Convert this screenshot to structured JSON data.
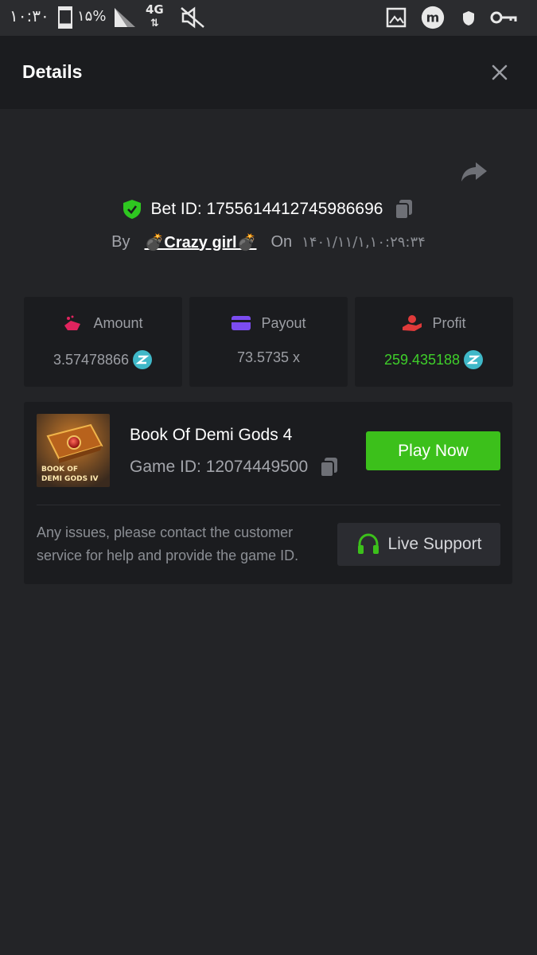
{
  "status_bar": {
    "time": "۱۰:۳۰",
    "battery": "۱۵%",
    "network": "4G",
    "icons": [
      "battery-icon",
      "signal-icon",
      "mute-icon",
      "gallery-icon",
      "app-m-icon",
      "shield-icon",
      "vpn-key-icon"
    ]
  },
  "header": {
    "title": "Details",
    "close_icon": "close-icon"
  },
  "bet": {
    "id_label": "Bet ID: 1755614412745986696",
    "by_label": "By",
    "user": "💣Crazy girl💣",
    "on_label": "On",
    "date": "۱۴۰۱/۱۱/۱,۱۰:۲۹:۳۴"
  },
  "stats": [
    {
      "label": "Amount",
      "value": "3.57478866",
      "icon": "amount-hand-icon",
      "icon_color": "#e0245e",
      "coin": true
    },
    {
      "label": "Payout",
      "value": "73.5735 x",
      "icon": "card-icon",
      "icon_color": "#7b4cf0",
      "coin": false
    },
    {
      "label": "Profit",
      "value": "259.435188",
      "icon": "profit-hand-icon",
      "icon_color": "#e03a3a",
      "coin": true,
      "value_color": "#3fcf2a"
    }
  ],
  "game": {
    "title": "Book Of Demi Gods 4",
    "id_label": "Game ID: 12074449500",
    "thumb_text": "BOOK OF DEMI GODS IV",
    "play_label": "Play Now",
    "help_text": "Any issues, please contact the customer service for help and provide the game ID.",
    "support_label": "Live Support"
  },
  "colors": {
    "accent_green": "#3cc01b",
    "background": "#232427",
    "panel": "#1b1c1f"
  }
}
